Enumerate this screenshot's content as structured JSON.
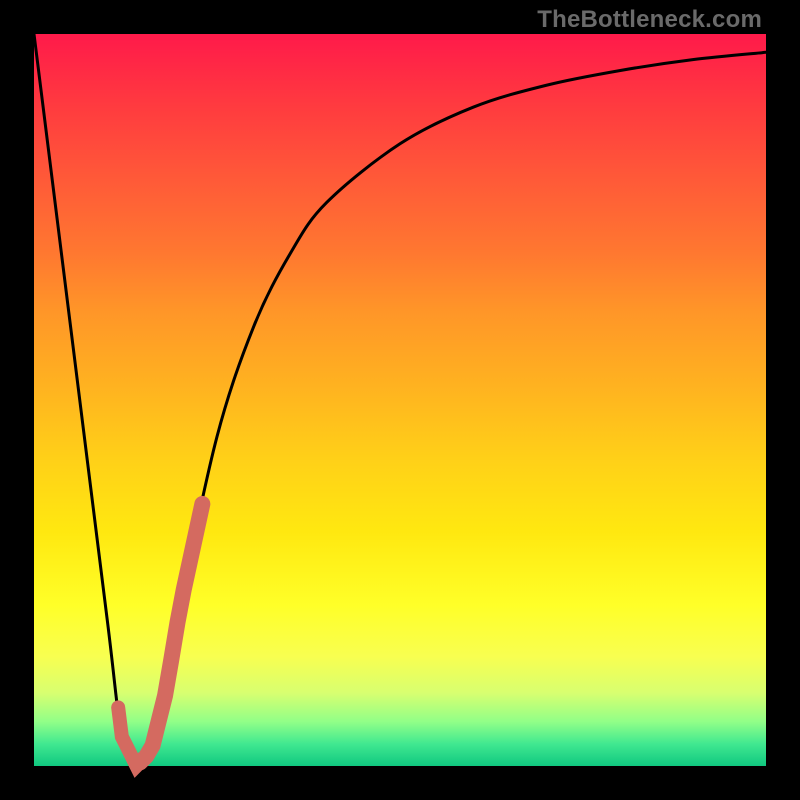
{
  "watermark": "TheBottleneck.com",
  "colors": {
    "frame": "#000000",
    "curve": "#000000",
    "accent": "#d46a60",
    "gradient_top": "#ff1a4a",
    "gradient_bottom": "#10c880"
  },
  "chart_data": {
    "type": "line",
    "title": "",
    "xlabel": "",
    "ylabel": "",
    "xlim": [
      0,
      100
    ],
    "ylim": [
      0,
      100
    ],
    "series": [
      {
        "name": "bottleneck-curve",
        "x": [
          0,
          5,
          10,
          12,
          14,
          16,
          18,
          20,
          25,
          30,
          35,
          40,
          50,
          60,
          70,
          80,
          90,
          100
        ],
        "y": [
          100,
          60,
          20,
          4,
          0,
          2,
          10,
          22,
          45,
          60,
          70,
          77,
          85,
          90,
          93,
          95,
          96.5,
          97.5
        ]
      }
    ],
    "accent_segment": {
      "name": "highlight",
      "x_start": 14.5,
      "x_end": 23,
      "note": "thick rounded coral stroke along rising slope near trough"
    },
    "accent_flat": {
      "name": "trough-highlight",
      "x_start": 11.5,
      "x_end": 14.5
    }
  }
}
